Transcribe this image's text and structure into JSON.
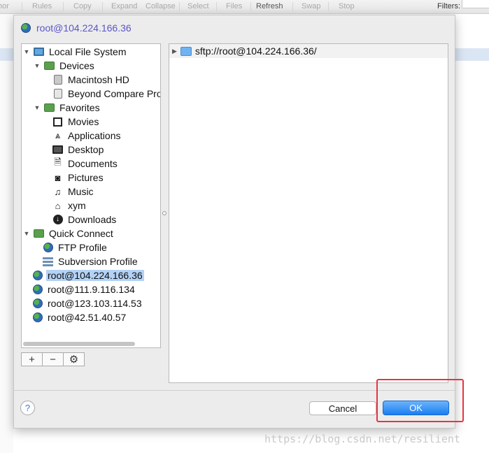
{
  "toolbar": {
    "items": [
      "hor",
      "Rules",
      "Copy",
      "Expand",
      "Collapse",
      "Select",
      "Files",
      "Refresh",
      "Swap",
      "Stop"
    ],
    "filters_label": "Filters:"
  },
  "dialog": {
    "title": "root@104.224.166.36",
    "tree": {
      "local_file_system": "Local File System",
      "devices": "Devices",
      "macintosh_hd": "Macintosh HD",
      "beyond_compare_pro": "Beyond Compare Pro",
      "favorites": "Favorites",
      "movies": "Movies",
      "applications": "Applications",
      "desktop": "Desktop",
      "documents": "Documents",
      "pictures": "Pictures",
      "music": "Music",
      "xym": "xym",
      "downloads": "Downloads",
      "quick_connect": "Quick Connect",
      "ftp_profile": "FTP Profile",
      "subversion_profile": "Subversion Profile",
      "hosts": [
        "root@104.224.166.36",
        "root@111.9.116.134",
        "root@123.103.114.53",
        "root@42.51.40.57"
      ]
    },
    "tree_buttons": {
      "add": "+",
      "remove": "−",
      "settings": "⚙"
    },
    "browse_path": "sftp://root@104.224.166.36/",
    "help": "?",
    "cancel_label": "Cancel",
    "ok_label": "OK"
  },
  "watermark": "https://blog.csdn.net/resilient",
  "colors": {
    "accent": "#1a7ef2",
    "selection": "#b3d2f5",
    "annotation": "#e8343f",
    "title": "#5a55c7"
  }
}
